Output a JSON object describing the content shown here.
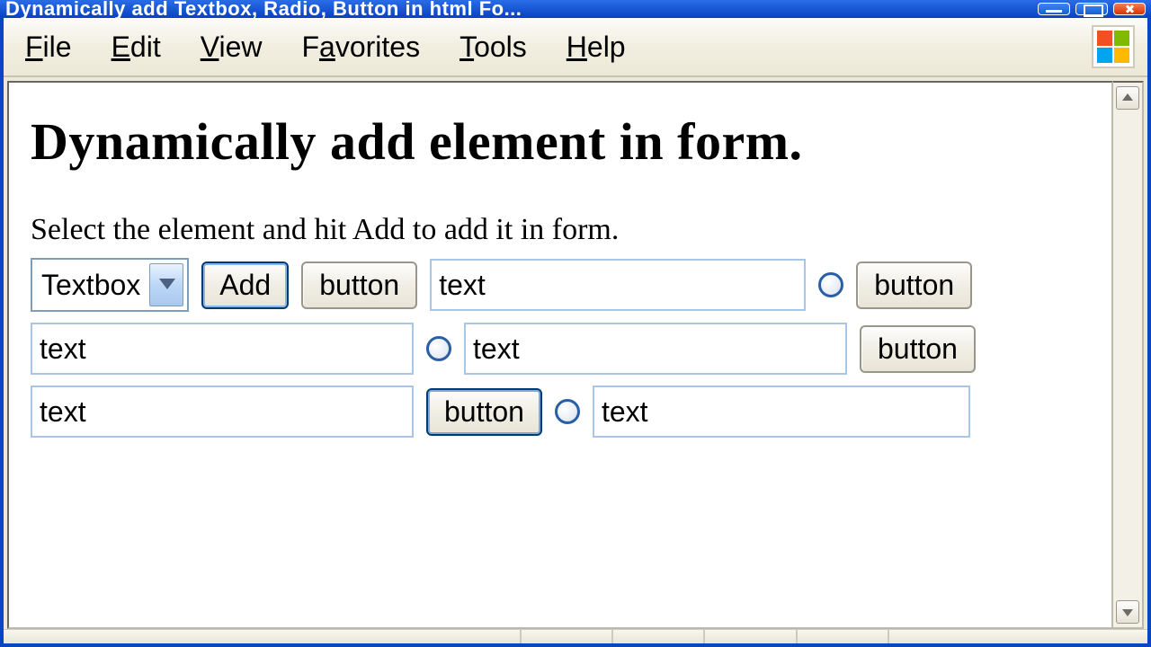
{
  "titlebar": {
    "text": "Dynamically add Textbox, Radio, Button in html Fo..."
  },
  "menubar": {
    "items": [
      {
        "accel": "F",
        "rest": "ile"
      },
      {
        "accel": "E",
        "rest": "dit"
      },
      {
        "accel": "V",
        "rest": "iew"
      },
      {
        "accel": "a",
        "pre": "F",
        "rest": "vorites"
      },
      {
        "accel": "T",
        "rest": "ools"
      },
      {
        "accel": "H",
        "rest": "elp"
      }
    ]
  },
  "page": {
    "heading": "Dynamically add element in form.",
    "instruction": "Select the element and hit Add to add it in form."
  },
  "controls": {
    "select_value": "Textbox",
    "add_label": "Add"
  },
  "elements": [
    {
      "type": "button",
      "label": "button"
    },
    {
      "type": "text",
      "value": "text"
    },
    {
      "type": "radio"
    },
    {
      "type": "button",
      "label": "button"
    },
    {
      "type": "text",
      "value": "text"
    },
    {
      "type": "radio"
    },
    {
      "type": "text",
      "value": "text"
    },
    {
      "type": "button",
      "label": "button"
    },
    {
      "type": "text",
      "value": "text"
    },
    {
      "type": "button",
      "label": "button",
      "hover": true
    },
    {
      "type": "radio"
    },
    {
      "type": "text",
      "value": "text"
    }
  ]
}
